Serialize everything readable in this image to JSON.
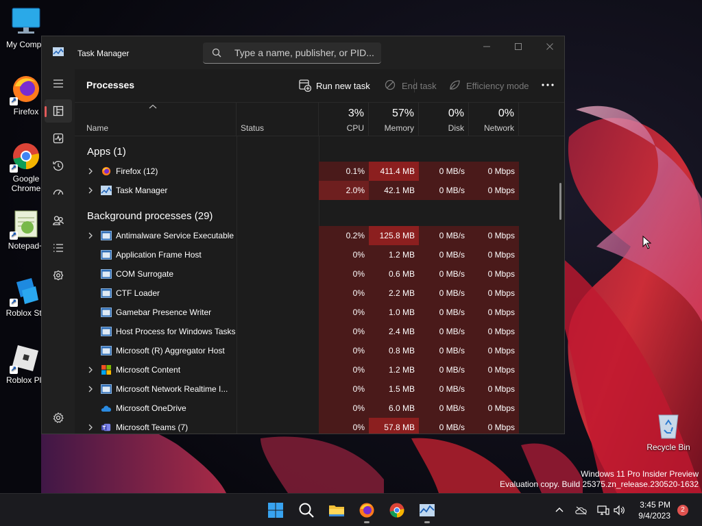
{
  "desktop": {
    "icons": [
      {
        "label": "My Compu"
      },
      {
        "label": "Firefox"
      },
      {
        "label": "Google Chrome"
      },
      {
        "label": "Notepad+"
      },
      {
        "label": "Roblox Stu"
      },
      {
        "label": "Roblox Pla"
      },
      {
        "label": "Recycle Bin"
      }
    ],
    "watermark": {
      "line1": "Windows 11 Pro Insider Preview",
      "line2": "Evaluation copy. Build 25375.zn_release.230520-1632"
    }
  },
  "window": {
    "title": "Task Manager",
    "search_placeholder": "Type a name, publisher, or PID..."
  },
  "nav": {
    "items": [
      "menu-icon",
      "processes-icon",
      "performance-icon",
      "app-history-icon",
      "startup-apps-icon",
      "users-icon",
      "details-icon",
      "services-icon",
      "settings-icon"
    ],
    "active": "processes"
  },
  "toolbar": {
    "page_title": "Processes",
    "run_new_task": "Run new task",
    "end_task": "End task",
    "efficiency_mode": "Efficiency mode"
  },
  "columns": {
    "name": "Name",
    "status": "Status",
    "cpu": {
      "label": "CPU",
      "pct": "3%"
    },
    "memory": {
      "label": "Memory",
      "pct": "57%"
    },
    "disk": {
      "label": "Disk",
      "pct": "0%"
    },
    "network": {
      "label": "Network",
      "pct": "0%"
    }
  },
  "groups": {
    "apps": "Apps (1)",
    "background": "Background processes (29)"
  },
  "apps": [
    {
      "name": "Firefox (12)",
      "expandable": true,
      "icon": "firefox",
      "cpu": "0.1%",
      "memory": "411.4 MB",
      "disk": "0 MB/s",
      "network": "0 Mbps"
    },
    {
      "name": "Task Manager",
      "expandable": true,
      "icon": "taskmgr",
      "cpu": "2.0%",
      "memory": "42.1 MB",
      "disk": "0 MB/s",
      "network": "0 Mbps"
    }
  ],
  "background": [
    {
      "name": "Antimalware Service Executable",
      "expandable": true,
      "icon": "window",
      "cpu": "0.2%",
      "memory": "125.8 MB",
      "disk": "0 MB/s",
      "network": "0 Mbps"
    },
    {
      "name": "Application Frame Host",
      "expandable": false,
      "icon": "window",
      "cpu": "0%",
      "memory": "1.2 MB",
      "disk": "0 MB/s",
      "network": "0 Mbps"
    },
    {
      "name": "COM Surrogate",
      "expandable": false,
      "icon": "window",
      "cpu": "0%",
      "memory": "0.6 MB",
      "disk": "0 MB/s",
      "network": "0 Mbps"
    },
    {
      "name": "CTF Loader",
      "expandable": false,
      "icon": "window",
      "cpu": "0%",
      "memory": "2.2 MB",
      "disk": "0 MB/s",
      "network": "0 Mbps"
    },
    {
      "name": "Gamebar Presence Writer",
      "expandable": false,
      "icon": "window",
      "cpu": "0%",
      "memory": "1.0 MB",
      "disk": "0 MB/s",
      "network": "0 Mbps"
    },
    {
      "name": "Host Process for Windows Tasks",
      "expandable": false,
      "icon": "window",
      "cpu": "0%",
      "memory": "2.4 MB",
      "disk": "0 MB/s",
      "network": "0 Mbps"
    },
    {
      "name": "Microsoft (R) Aggregator Host",
      "expandable": false,
      "icon": "window",
      "cpu": "0%",
      "memory": "0.8 MB",
      "disk": "0 MB/s",
      "network": "0 Mbps"
    },
    {
      "name": "Microsoft Content",
      "expandable": true,
      "icon": "mslogo",
      "cpu": "0%",
      "memory": "1.2 MB",
      "disk": "0 MB/s",
      "network": "0 Mbps"
    },
    {
      "name": "Microsoft Network Realtime I...",
      "expandable": true,
      "icon": "window",
      "cpu": "0%",
      "memory": "1.5 MB",
      "disk": "0 MB/s",
      "network": "0 Mbps"
    },
    {
      "name": "Microsoft OneDrive",
      "expandable": false,
      "icon": "onedrive",
      "cpu": "0%",
      "memory": "6.0 MB",
      "disk": "0 MB/s",
      "network": "0 Mbps"
    },
    {
      "name": "Microsoft Teams (7)",
      "expandable": true,
      "icon": "teams",
      "cpu": "0%",
      "memory": "57.8 MB",
      "disk": "0 MB/s",
      "network": "0 Mbps"
    }
  ],
  "taskbar": {
    "apps": [
      "start-icon",
      "search-icon",
      "file-explorer-icon",
      "firefox-icon",
      "chrome-icon",
      "task-manager-icon"
    ],
    "time": "3:45 PM",
    "date": "9/4/2023",
    "notifications": "2"
  },
  "colors": {
    "heat_low": "#4a1a1a",
    "heat_mid": "#6e1f1f",
    "heat_high": "#8c1f1f",
    "accent": "#e05a5a"
  }
}
